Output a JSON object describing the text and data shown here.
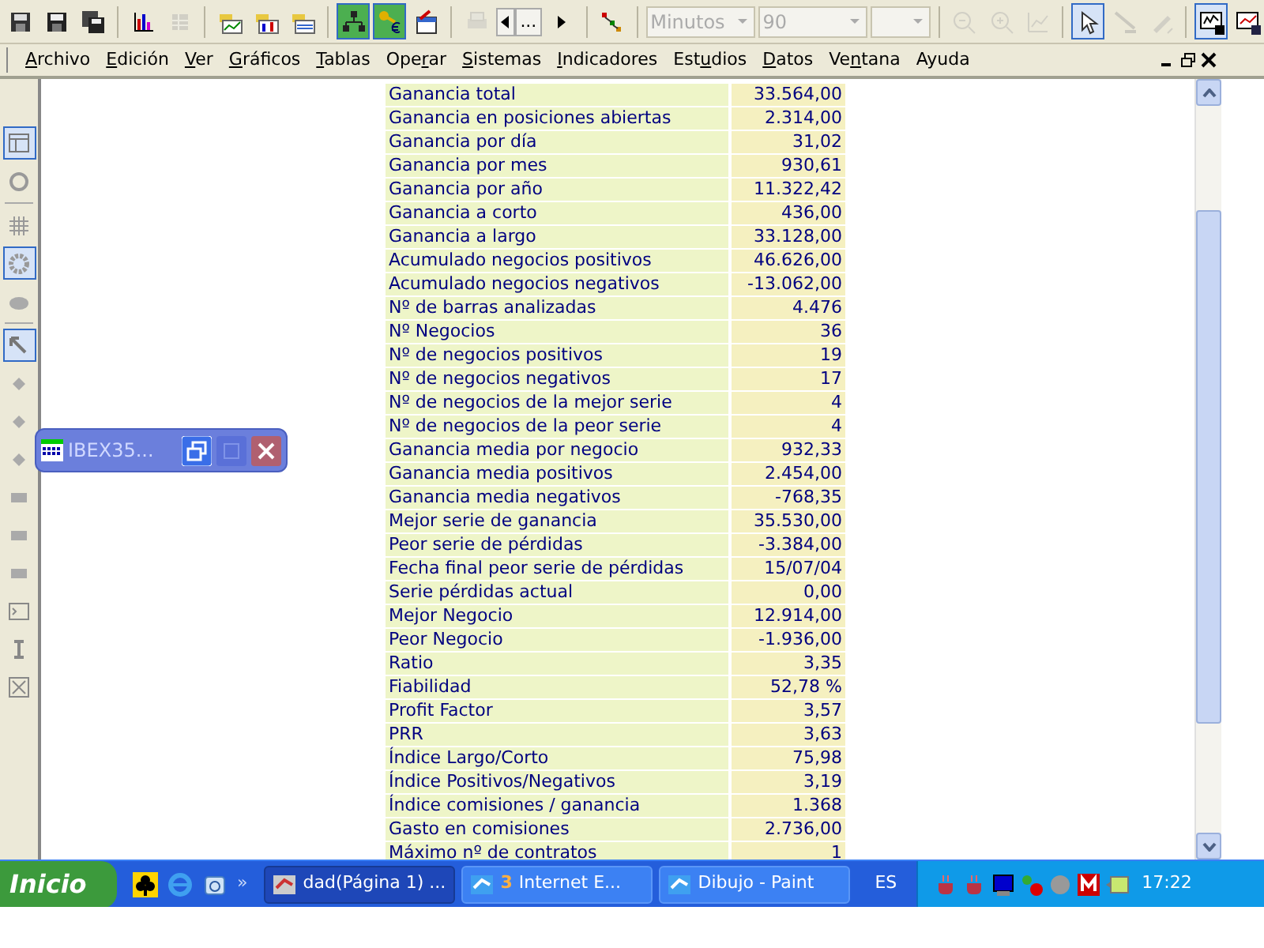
{
  "toolbar": [
    {
      "kind": "button",
      "selected": false,
      "disabled": false
    },
    {
      "kind": "button",
      "selected": false,
      "disabled": false
    },
    {
      "kind": "button",
      "selected": false,
      "disabled": false
    },
    {
      "kind": "separator"
    },
    {
      "kind": "button",
      "selected": false,
      "disabled": false
    },
    {
      "kind": "button",
      "selected": false,
      "disabled": true
    },
    {
      "kind": "separator"
    },
    {
      "kind": "button",
      "selected": false,
      "disabled": false
    },
    {
      "kind": "button",
      "selected": false,
      "disabled": false
    },
    {
      "kind": "button",
      "selected": false,
      "disabled": false
    },
    {
      "kind": "separator"
    },
    {
      "kind": "button",
      "selected": true,
      "disabled": false
    },
    {
      "kind": "button",
      "selected": true,
      "disabled": false
    },
    {
      "kind": "button",
      "selected": false,
      "disabled": false
    },
    {
      "kind": "separator"
    },
    {
      "kind": "button",
      "selected": false,
      "disabled": true
    },
    {
      "kind": "pager",
      "label": "..."
    },
    {
      "kind": "button",
      "selected": false,
      "disabled": false
    },
    {
      "kind": "separator"
    },
    {
      "kind": "button",
      "selected": false,
      "disabled": false
    },
    {
      "kind": "separator"
    },
    {
      "kind": "combo",
      "value": "Minutos",
      "disabled": true
    },
    {
      "kind": "combo",
      "value": "90",
      "disabled": true
    },
    {
      "kind": "combo",
      "disabled": true
    },
    {
      "kind": "separator"
    },
    {
      "kind": "button",
      "selected": false,
      "disabled": true
    },
    {
      "kind": "button",
      "selected": false,
      "disabled": true
    },
    {
      "kind": "button",
      "selected": false,
      "disabled": true
    },
    {
      "kind": "separator"
    },
    {
      "kind": "button",
      "selected": true,
      "disabled": false
    },
    {
      "kind": "button",
      "selected": false,
      "disabled": true
    },
    {
      "kind": "button",
      "selected": false,
      "disabled": true
    },
    {
      "kind": "separator"
    },
    {
      "kind": "button",
      "selected": true,
      "disabled": false
    },
    {
      "kind": "button",
      "selected": false,
      "disabled": false
    }
  ],
  "menu": [
    {
      "key": "A",
      "post": "rchivo"
    },
    {
      "key": "E",
      "post": "dición"
    },
    {
      "key": "V",
      "post": "er"
    },
    {
      "key": "G",
      "post": "ráficos"
    },
    {
      "key": "T",
      "post": "ablas"
    },
    {
      "pre": "Ope",
      "key": "r",
      "post": "ar"
    },
    {
      "key": "S",
      "post": "istemas"
    },
    {
      "key": "I",
      "post": "ndicadores"
    },
    {
      "pre": "Est",
      "key": "u",
      "post": "dios"
    },
    {
      "key": "D",
      "post": "atos"
    },
    {
      "pre": "Ve",
      "key": "n",
      "post": "tana"
    },
    {
      "pre": "Ayuda"
    }
  ],
  "side_tools": [
    {
      "kind": "button",
      "selected": true
    },
    {
      "kind": "button",
      "selected": false
    },
    {
      "kind": "separator"
    },
    {
      "kind": "button",
      "selected": false
    },
    {
      "kind": "button",
      "selected": true
    },
    {
      "kind": "button",
      "selected": false
    },
    {
      "kind": "separator"
    },
    {
      "kind": "button",
      "selected": true
    },
    {
      "kind": "button",
      "selected": false
    },
    {
      "kind": "button",
      "selected": false
    },
    {
      "kind": "button",
      "selected": false
    },
    {
      "kind": "button",
      "selected": false
    },
    {
      "kind": "button",
      "selected": false
    },
    {
      "kind": "button",
      "selected": false
    },
    {
      "kind": "button",
      "selected": false
    },
    {
      "kind": "button",
      "selected": false
    },
    {
      "kind": "button",
      "selected": false
    }
  ],
  "table": {
    "rows": [
      [
        "Ganancia total",
        "33.564,00"
      ],
      [
        "Ganancia en posiciones abiertas",
        "2.314,00"
      ],
      [
        "Ganancia por día",
        "31,02"
      ],
      [
        "Ganancia por mes",
        "930,61"
      ],
      [
        "Ganancia por año",
        "11.322,42"
      ],
      [
        "Ganancia a corto",
        "436,00"
      ],
      [
        "Ganancia a largo",
        "33.128,00"
      ],
      [
        "Acumulado negocios positivos",
        "46.626,00"
      ],
      [
        "Acumulado negocios negativos",
        "-13.062,00"
      ],
      [
        "Nº de barras analizadas",
        "4.476"
      ],
      [
        "Nº Negocios",
        "36"
      ],
      [
        "Nº de negocios positivos",
        "19"
      ],
      [
        "Nº de negocios negativos",
        "17"
      ],
      [
        "Nº de negocios de la mejor serie",
        "4"
      ],
      [
        "Nº de negocios de la peor serie",
        "4"
      ],
      [
        "Ganancia media por negocio",
        "932,33"
      ],
      [
        "Ganancia media positivos",
        "2.454,00"
      ],
      [
        "Ganancia media negativos",
        "-768,35"
      ],
      [
        "Mejor serie de ganancia",
        "35.530,00"
      ],
      [
        "Peor serie de pérdidas",
        "-3.384,00"
      ],
      [
        "Fecha final peor serie de pérdidas",
        "15/07/04"
      ],
      [
        "Serie pérdidas actual",
        "0,00"
      ],
      [
        "Mejor Negocio",
        "12.914,00"
      ],
      [
        "Peor Negocio",
        "-1.936,00"
      ],
      [
        "Ratio",
        "3,35"
      ],
      [
        "Fiabilidad",
        "52,78 %"
      ],
      [
        "Profit Factor",
        "3,57"
      ],
      [
        "PRR",
        "3,63"
      ],
      [
        "Índice Largo/Corto",
        "75,98"
      ],
      [
        "Índice Positivos/Negativos",
        "3,19"
      ],
      [
        "Índice comisiones / ganancia",
        "1.368"
      ],
      [
        "Gasto en comisiones",
        "2.736,00"
      ],
      [
        "Máximo nº de contratos",
        "1"
      ]
    ]
  },
  "mini_window": {
    "title": "IBEX35..."
  },
  "taskbar": {
    "start": "Inicio",
    "more": "»",
    "tasks": [
      {
        "label": "dad(Página 1) ...",
        "selected": true
      },
      {
        "label": "Internet E...",
        "count": "3",
        "selected": false
      },
      {
        "label": "Dibujo - Paint",
        "selected": false
      }
    ],
    "language": "ES",
    "clock": "17:22"
  }
}
